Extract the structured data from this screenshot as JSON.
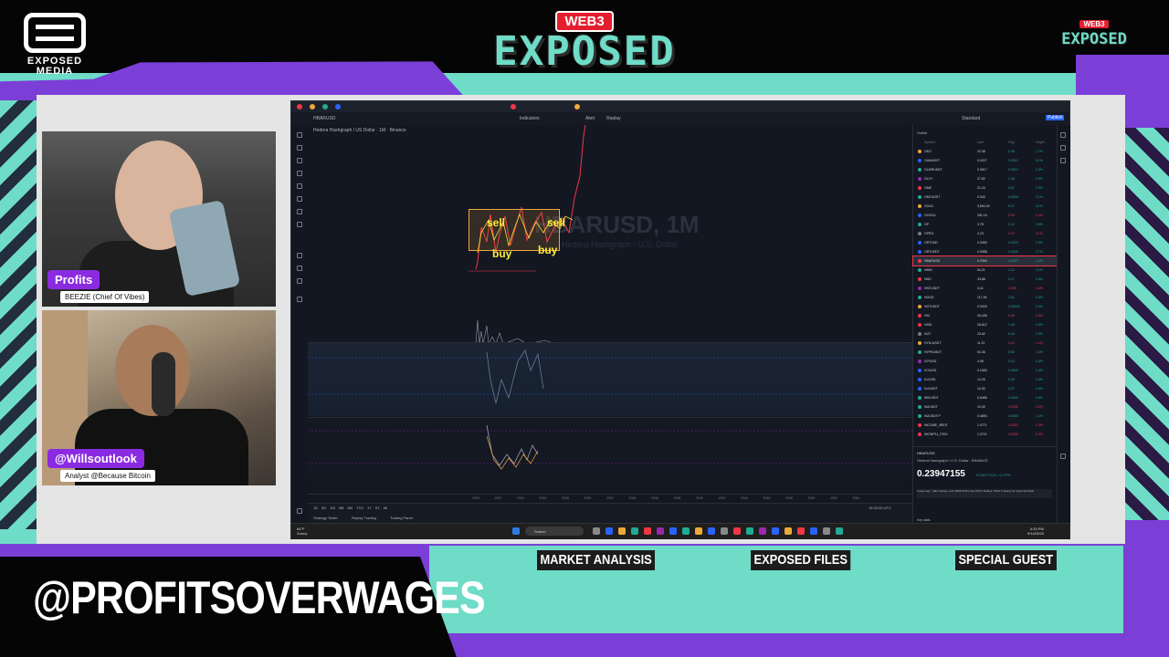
{
  "branding": {
    "left_logo_text": "EXPOSED MEDIA",
    "center_badge": "WEB3",
    "center_title": "EXPOSED",
    "right_badge": "WEB3",
    "right_title": "EXPOSED"
  },
  "cams": [
    {
      "name": "Profits",
      "role": "BEEZIE (Chief Of Vibes)"
    },
    {
      "name": "@Willsoutlook",
      "role": "Analyst @Because Bitcoin"
    }
  ],
  "chart": {
    "symbol_title": "Hedera Hashgraph / US Dollar · 1M · Binance",
    "watermark": "HBARUSD, 1M",
    "watermark_sub": "Hedera Hashgraph / U.S. Dollar",
    "annotations": {
      "sell_1": "sell",
      "sell_2": "sell",
      "buy_1": "buy",
      "buy_2": "buy"
    },
    "time_labels": [
      "2020",
      "2022",
      "2024",
      "2026",
      "2028",
      "2030",
      "2032",
      "2034",
      "2036",
      "2038",
      "2040",
      "2042",
      "2044",
      "2046",
      "2048",
      "2050",
      "2052",
      "2054"
    ],
    "range_buttons": [
      "1D",
      "5D",
      "1M",
      "3M",
      "6M",
      "YTD",
      "1Y",
      "5Y",
      "All"
    ],
    "bottom_tabs": [
      "Strategy Tester",
      "Replay Trading",
      "Trading Panel"
    ],
    "timestamp": "15:33:40 UTC"
  },
  "toolbar": {
    "indicators": "Indicators",
    "alert": "Alert",
    "replay": "Replay",
    "publish": "Publish",
    "standard": "Standard"
  },
  "watchlist": {
    "title": "Hotlist",
    "columns": {
      "symbol": "Symbol",
      "last": "Last",
      "chg": "Chg",
      "pct": "Chg%"
    },
    "rows": [
      {
        "sym": "GEO",
        "last": "22.48",
        "chg": "0.38",
        "pct": "1.7%",
        "dot": "#f0a83a",
        "up": true
      },
      {
        "sym": "GANUSDT",
        "last": "0.0227",
        "chg": "0.0012",
        "pct": "5.1%",
        "dot": "#2962ff",
        "up": true
      },
      {
        "sym": "GLMRUSDT",
        "last": "0.0617",
        "chg": "0.0012",
        "pct": "2.0%",
        "dot": "#22ab94",
        "up": true
      },
      {
        "sym": "GLXY",
        "last": "27.82",
        "chg": "1.06",
        "pct": "3.9%",
        "dot": "#9c27b0",
        "up": true
      },
      {
        "sym": "GME",
        "last": "21.24",
        "chg": "0.61",
        "pct": "2.9%",
        "dot": "#f23645",
        "up": true
      },
      {
        "sym": "GMTUSDT",
        "last": "0.043",
        "chg": "0.0009",
        "pct": "2.1%",
        "dot": "#22ab94",
        "up": true
      },
      {
        "sym": "GOLD",
        "last": "3,694.40",
        "chg": "5.07",
        "pct": "0.1%",
        "dot": "#f0a83a",
        "up": true
      },
      {
        "sym": "GOOGL",
        "last": "251.16",
        "chg": "0.45",
        "pct": "0.2%",
        "dot": "#2962ff",
        "up": false
      },
      {
        "sym": "GP",
        "last": "3.78",
        "chg": "0.10",
        "pct": "2.6%",
        "dot": "#22ab94",
        "up": true
      },
      {
        "sym": "GPRO",
        "last": "2.23",
        "chg": "0.07",
        "pct": "3.1%",
        "dot": "#787b86",
        "up": false
      },
      {
        "sym": "GRTUSD",
        "last": "0.0983",
        "chg": "0.0022",
        "pct": "2.3%",
        "dot": "#2962ff",
        "up": true
      },
      {
        "sym": "GRTUSDT",
        "last": "0.0988",
        "chg": "0.0026",
        "pct": "2.7%",
        "dot": "#2962ff",
        "up": true
      },
      {
        "sym": "HBARUSD",
        "last": "0.2394",
        "chg": "0.0027",
        "pct": "1.2%",
        "dot": "#f23645",
        "up": true,
        "selected": true
      },
      {
        "sym": "HIMS",
        "last": "54.21",
        "chg": "1.12",
        "pct": "2.1%",
        "dot": "#22ab94",
        "up": true
      },
      {
        "sym": "HMC",
        "last": "33.88",
        "chg": "0.17",
        "pct": "0.5%",
        "dot": "#f23645",
        "up": true
      },
      {
        "sym": "HNTUSDT",
        "last": "3.41",
        "chg": "0.008",
        "pct": "0.2%",
        "dot": "#9c27b0",
        "up": false
      },
      {
        "sym": "HOOD",
        "last": "117.36",
        "chg": "2.61",
        "pct": "2.3%",
        "dot": "#22ab94",
        "up": true
      },
      {
        "sym": "HOTUSDT",
        "last": "0.0009",
        "chg": "0.00002",
        "pct": "2.2%",
        "dot": "#f0a83a",
        "up": true
      },
      {
        "sym": "HSI",
        "last": "26,438",
        "chg": "0.08",
        "pct": "0.0%",
        "dot": "#f23645",
        "up": false
      },
      {
        "sym": "HSDI",
        "last": "26,612",
        "chg": "1.45",
        "pct": "0.0%",
        "dot": "#f23645",
        "up": true
      },
      {
        "sym": "HUT",
        "last": "23.62",
        "chg": "0.44",
        "pct": "1.9%",
        "dot": "#787b86",
        "up": true
      },
      {
        "sym": "HYM.USDT",
        "last": "11.21",
        "chg": "0.12",
        "pct": "1.1%",
        "dot": "#f0a83a",
        "up": false
      },
      {
        "sym": "HYPEUSDT",
        "last": "54.36",
        "chg": "0.52",
        "pct": "1.0%",
        "dot": "#22ab94",
        "up": true
      },
      {
        "sym": "ICPUSD",
        "last": "4.98",
        "chg": "0.12",
        "pct": "2.4%",
        "dot": "#9c27b0",
        "up": true
      },
      {
        "sym": "ICXUSD",
        "last": "0.1683",
        "chg": "0.0040",
        "pct": "2.4%",
        "dot": "#2962ff",
        "up": true
      },
      {
        "sym": "ILVUSD",
        "last": "14.26",
        "chg": "0.32",
        "pct": "2.3%",
        "dot": "#2962ff",
        "up": true
      },
      {
        "sym": "ILVUSDT",
        "last": "14.30",
        "chg": "0.37",
        "pct": "2.6%",
        "dot": "#2962ff",
        "up": true
      },
      {
        "sym": "IMXUSDT",
        "last": "0.6486",
        "chg": "0.0042",
        "pct": "0.6%",
        "dot": "#22ab94",
        "up": true
      },
      {
        "sym": "INJUSDT",
        "last": "13.49",
        "chg": "0.0032",
        "pct": "0.2%",
        "dot": "#22ab94",
        "up": false
      },
      {
        "sym": "INJUSDT.P",
        "last": "0.4894",
        "chg": "0.0055",
        "pct": "1.1%",
        "dot": "#22ab94",
        "up": true
      },
      {
        "sym": "INCOME_4REIT",
        "last": "1.4771",
        "chg": "0.0052",
        "pct": "0.3%",
        "dot": "#f23645",
        "up": false
      },
      {
        "sym": "INCWP11_F30X",
        "last": "1.4721",
        "chg": "0.0056",
        "pct": "0.4%",
        "dot": "#f23645",
        "up": false
      }
    ],
    "detail": {
      "symbol": "HBARUSD",
      "name": "Hedera Hashgraph / U.S. Dollar · BINANCE",
      "price": "0.23947155",
      "change": "+0.00277121 +1.17%",
      "news": "5 days ago · SEC Delays, and HBAR ETFs Get SPCC Delays: What It Means for Approval Odds",
      "stats": "Key stats"
    }
  },
  "taskbar": {
    "search": "Search",
    "time": "4:33 PM",
    "date": "9/14/2025",
    "weather_temp": "64°F",
    "weather_desc": "Sunny"
  },
  "lower_third": {
    "handle": "@PROFITSOVERWAGES",
    "segments": [
      "MARKET ANALYSIS",
      "EXPOSED FILES",
      "SPECIAL GUEST"
    ]
  },
  "colors": {
    "teal": "#6fdcc7",
    "purple": "#7b3fd8",
    "badge_purple": "#8a2be2",
    "web3_red": "#e41e2e",
    "tv_bg": "#131722",
    "tv_up": "#22ab94",
    "tv_down": "#f23645"
  }
}
